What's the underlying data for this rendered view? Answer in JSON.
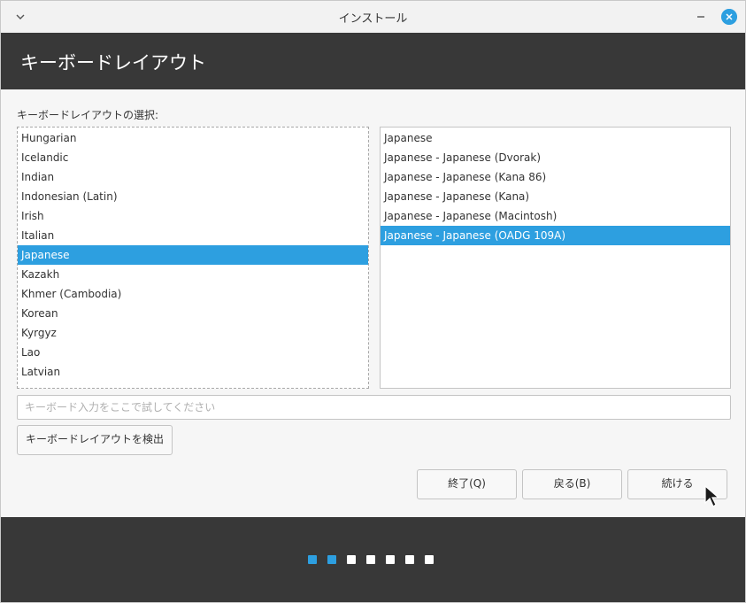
{
  "window": {
    "title": "インストール"
  },
  "header": {
    "title": "キーボードレイアウト"
  },
  "layout_section": {
    "label": "キーボードレイアウトの選択:"
  },
  "layouts": [
    {
      "label": "Hungarian",
      "selected": false
    },
    {
      "label": "Icelandic",
      "selected": false
    },
    {
      "label": "Indian",
      "selected": false
    },
    {
      "label": "Indonesian (Latin)",
      "selected": false
    },
    {
      "label": "Irish",
      "selected": false
    },
    {
      "label": "Italian",
      "selected": false
    },
    {
      "label": "Japanese",
      "selected": true
    },
    {
      "label": "Kazakh",
      "selected": false
    },
    {
      "label": "Khmer (Cambodia)",
      "selected": false
    },
    {
      "label": "Korean",
      "selected": false
    },
    {
      "label": "Kyrgyz",
      "selected": false
    },
    {
      "label": "Lao",
      "selected": false
    },
    {
      "label": "Latvian",
      "selected": false
    }
  ],
  "variants": [
    {
      "label": "Japanese",
      "selected": false
    },
    {
      "label": "Japanese - Japanese (Dvorak)",
      "selected": false
    },
    {
      "label": "Japanese - Japanese (Kana 86)",
      "selected": false
    },
    {
      "label": "Japanese - Japanese (Kana)",
      "selected": false
    },
    {
      "label": "Japanese - Japanese (Macintosh)",
      "selected": false
    },
    {
      "label": "Japanese - Japanese (OADG 109A)",
      "selected": true
    }
  ],
  "test_input": {
    "placeholder": "キーボード入力をここで試してください",
    "value": ""
  },
  "buttons": {
    "detect": "キーボードレイアウトを検出",
    "quit": "終了(Q)",
    "back": "戻る(B)",
    "continue": "続ける"
  },
  "progress": {
    "total_steps": 7,
    "current_step": 2
  },
  "colors": {
    "accent": "#2d9fe0",
    "header_bg": "#383838",
    "footer_bg": "#383838"
  }
}
